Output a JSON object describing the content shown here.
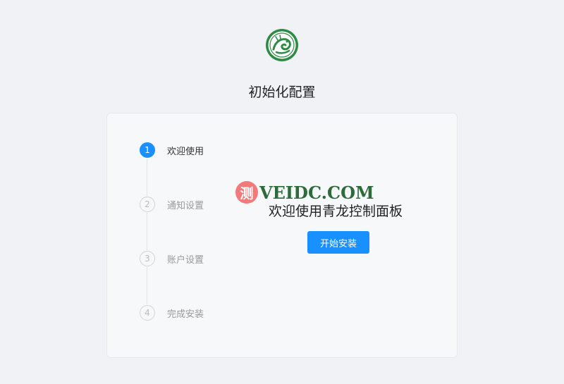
{
  "header": {
    "title": "初始化配置",
    "logo": "qinglong-dragon-logo"
  },
  "steps": [
    {
      "number": "1",
      "label": "欢迎使用",
      "status": "active"
    },
    {
      "number": "2",
      "label": "通知设置",
      "status": "wait"
    },
    {
      "number": "3",
      "label": "账户设置",
      "status": "wait"
    },
    {
      "number": "4",
      "label": "完成安装",
      "status": "wait"
    }
  ],
  "content": {
    "welcome": "欢迎使用青龙控制面板",
    "start_button": "开始安装"
  },
  "watermark": {
    "badge": "测",
    "text": "VEIDC.COM"
  },
  "colors": {
    "primary": "#1890ff",
    "logo_green": "#2e8b46",
    "background": "#f0f2f5"
  }
}
